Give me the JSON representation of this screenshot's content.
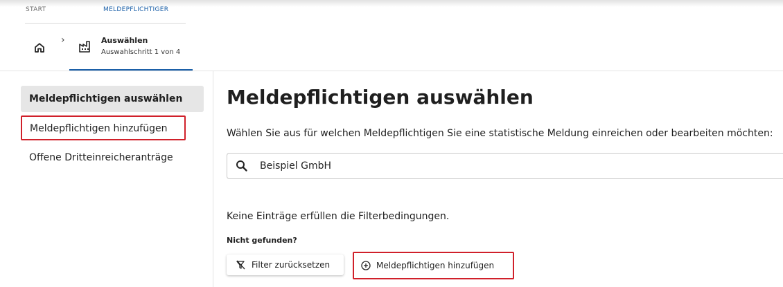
{
  "breadcrumb": {
    "start": "START",
    "current": "MELDEPFLICHTIGER"
  },
  "step": {
    "title": "Auswählen",
    "subtitle": "Auswahlschritt 1 von 4"
  },
  "sidebar": {
    "items": [
      {
        "label": "Meldepflichtigen auswählen"
      },
      {
        "label": "Meldepflichtigen hinzufügen"
      },
      {
        "label": "Offene Dritteinreicheranträge"
      }
    ]
  },
  "main": {
    "title": "Meldepflichtigen auswählen",
    "intro": "Wählen Sie aus für welchen Meldepflichtigen Sie eine statistische Meldung einreichen oder bearbeiten möchten:",
    "search_value": "Beispiel GmbH",
    "empty_message": "Keine Einträge erfüllen die Filterbedingungen.",
    "not_found": "Nicht gefunden?",
    "reset_button": "Filter zurücksetzen",
    "add_button": "Meldepflichtigen hinzufügen"
  },
  "colors": {
    "accent": "#1a5fa8",
    "highlight": "#d0202a",
    "active_bg": "#e6e6e6"
  },
  "icons": [
    "home-icon",
    "chevron-right-icon",
    "factory-icon",
    "search-icon",
    "filter-clear-icon",
    "plus-circle-icon"
  ]
}
